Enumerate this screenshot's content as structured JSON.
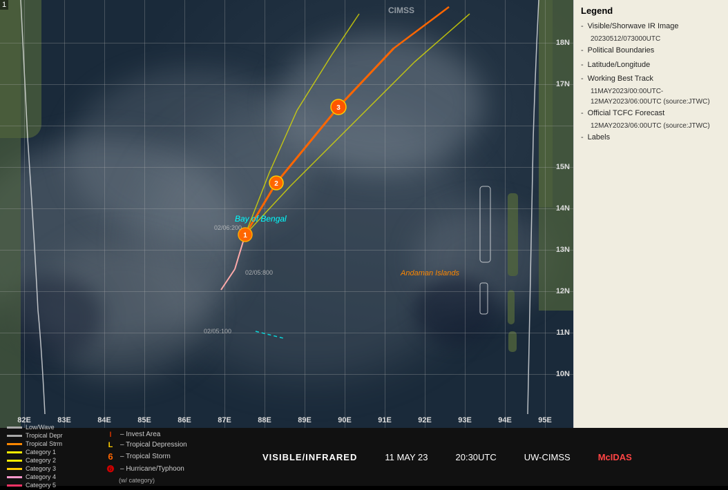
{
  "legend": {
    "title": "Legend",
    "items": [
      {
        "label": "Visible/Shorwave IR Image",
        "sub": "20230512/073000UTC"
      },
      {
        "label": "Political Boundaries"
      },
      {
        "label": "Latitude/Longitude"
      },
      {
        "label": "Working Best Track",
        "sub": "11MAY2023/00:00UTC-\n12MAY2023/06:00UTC  (source:JTWC)"
      },
      {
        "label": "Official TCFC Forecast",
        "sub": "12MAY2023/06:00UTC  (source:JTWC)"
      },
      {
        "label": "Labels"
      }
    ]
  },
  "bottom_bar": {
    "vis_label": "VISIBLE/INFRARED",
    "date": "11 MAY 23",
    "time": "20:30UTC",
    "source": "UW-CIMSS",
    "software": "McIDAS"
  },
  "track_legend": {
    "colors": [
      {
        "name": "Low/Wave",
        "color": "#aaa"
      },
      {
        "name": "Tropical Depr",
        "color": "#aaa"
      },
      {
        "name": "Tropical Strm",
        "color": "#ff8800"
      },
      {
        "name": "Category 1",
        "color": "#ffee00"
      },
      {
        "name": "Category 2",
        "color": "#ffee00"
      },
      {
        "name": "Category 3",
        "color": "#ffcc00"
      },
      {
        "name": "Category 4",
        "color": "#ff99cc"
      },
      {
        "name": "Category 5",
        "color": "#ff3366"
      }
    ],
    "icons": [
      {
        "symbol": "I",
        "label": "– Invest Area",
        "color": "#cc3300"
      },
      {
        "symbol": "L",
        "label": "– Tropical Depression",
        "color": "#ffcc00"
      },
      {
        "symbol": "6",
        "label": "– Tropical Storm",
        "color": "#ff6600"
      },
      {
        "symbol": "❻",
        "label": "– Hurricane/Typhoon",
        "color": "#cc0000"
      }
    ]
  },
  "map": {
    "bay_of_bengal_label": "Bay of Bengal",
    "andaman_label": "Andaman Islands",
    "watermark": "CIMSS",
    "corner_num": "1",
    "lat_labels": [
      "18N",
      "17N",
      "15N",
      "14N",
      "13N",
      "12N",
      "11N",
      "10N"
    ],
    "lon_labels": [
      "82E",
      "83E",
      "84E",
      "85E",
      "86E",
      "87E",
      "88E",
      "89E",
      "90E",
      "91E",
      "92E",
      "93E",
      "94E",
      "95E"
    ]
  }
}
